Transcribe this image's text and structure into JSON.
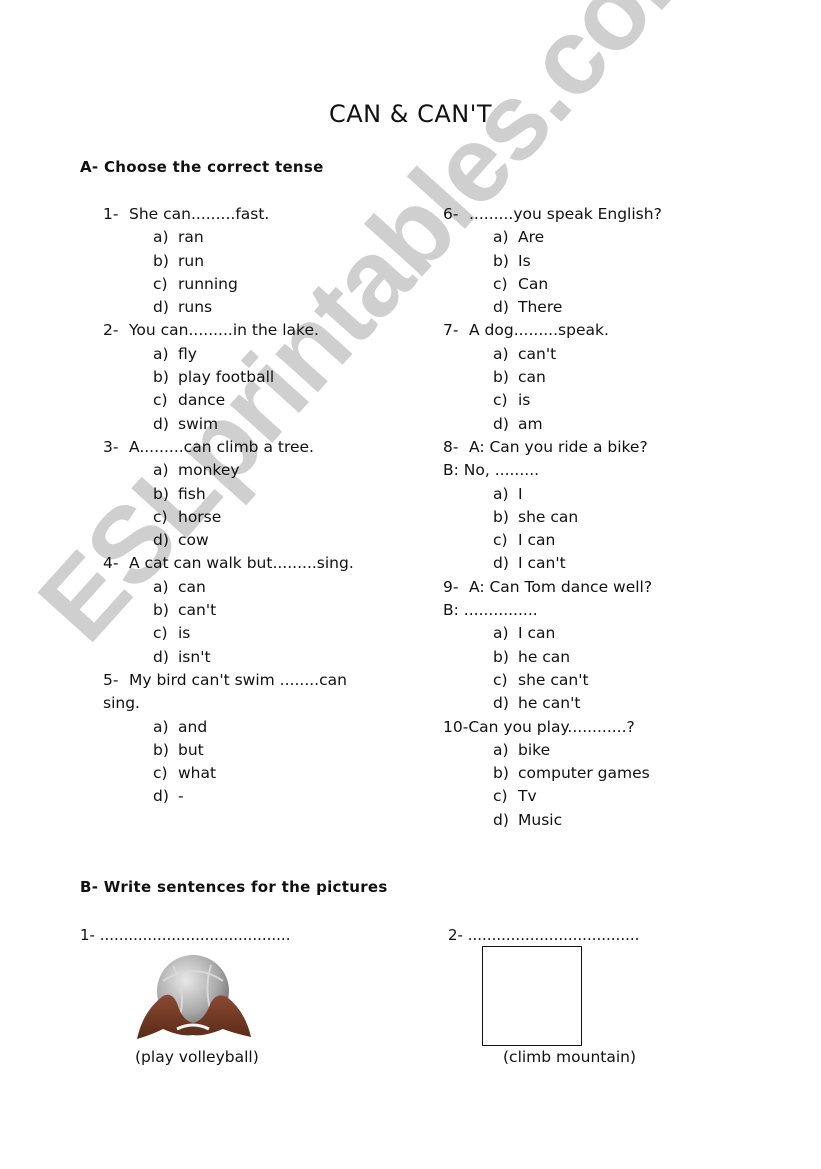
{
  "title": "CAN & CAN'T",
  "watermark": "ESLprintables.com",
  "section_a": {
    "heading": "A-  Choose the correct tense",
    "questions": [
      {
        "num": "1-",
        "text": "She can.........fast.",
        "options": [
          [
            "a)",
            "ran"
          ],
          [
            "b)",
            "run"
          ],
          [
            "c)",
            "running"
          ],
          [
            "d)",
            "runs"
          ]
        ]
      },
      {
        "num": "2-",
        "text": "You can.........in the lake.",
        "options": [
          [
            "a)",
            "fly"
          ],
          [
            "b)",
            "play football"
          ],
          [
            "c)",
            "dance"
          ],
          [
            "d)",
            "swim"
          ]
        ]
      },
      {
        "num": "3-",
        "text": "A.........can climb a tree.",
        "options": [
          [
            "a)",
            "monkey"
          ],
          [
            "b)",
            "fish"
          ],
          [
            "c)",
            "horse"
          ],
          [
            "d)",
            "cow"
          ]
        ]
      },
      {
        "num": "4-",
        "text": "A cat can walk but.........sing.",
        "options": [
          [
            "a)",
            "can"
          ],
          [
            "b)",
            "can't"
          ],
          [
            "c)",
            "is"
          ],
          [
            "d)",
            "isn't"
          ]
        ]
      },
      {
        "num": "5-",
        "text": "My bird can't swim ........can",
        "text2": "sing.",
        "options": [
          [
            "a)",
            "and"
          ],
          [
            "b)",
            "but"
          ],
          [
            "c)",
            "what"
          ],
          [
            "d)",
            "-"
          ]
        ]
      },
      {
        "num": "6-",
        "text": ".........you speak English?",
        "options": [
          [
            "a)",
            "Are"
          ],
          [
            "b)",
            "Is"
          ],
          [
            "c)",
            "Can"
          ],
          [
            "d)",
            "There"
          ]
        ]
      },
      {
        "num": "7-",
        "text": "A dog.........speak.",
        "options": [
          [
            "a)",
            "can't"
          ],
          [
            "b)",
            "can"
          ],
          [
            "c)",
            "is"
          ],
          [
            "d)",
            "am"
          ]
        ]
      },
      {
        "num": "8-",
        "text": "A: Can you ride a bike?",
        "text2": "B: No, .........",
        "options": [
          [
            "a)",
            "I"
          ],
          [
            "b)",
            "she can"
          ],
          [
            "c)",
            "I can"
          ],
          [
            "d)",
            "I can't"
          ]
        ]
      },
      {
        "num": "9-",
        "text": "A: Can Tom dance well?",
        "text2": "B: ...............",
        "options": [
          [
            "a)",
            "I can"
          ],
          [
            "b)",
            "he can"
          ],
          [
            "c)",
            "she can't"
          ],
          [
            "d)",
            "he can't"
          ]
        ]
      },
      {
        "num": "10-",
        "text": "Can you play............?",
        "options": [
          [
            "a)",
            "bike"
          ],
          [
            "b)",
            "computer games"
          ],
          [
            "c)",
            "Tv"
          ],
          [
            "d)",
            "Music"
          ]
        ]
      }
    ]
  },
  "section_b": {
    "heading": "B-  Write sentences for the pictures",
    "items": [
      {
        "num": "1-",
        "blank": "........................................",
        "picture": "volleyball-image",
        "caption": "(play volleyball)"
      },
      {
        "num": "2-",
        "blank": "....................................",
        "picture": "empty-picture-box",
        "caption": "(climb mountain)"
      }
    ]
  }
}
